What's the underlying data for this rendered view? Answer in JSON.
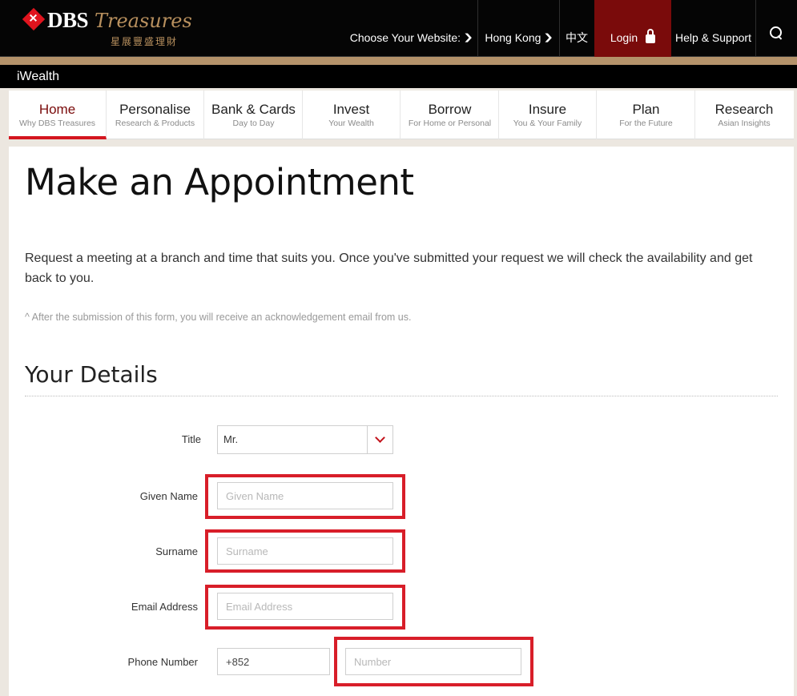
{
  "header": {
    "brand": "DBS",
    "brand_script": "Treasures",
    "brand_cn": "星展豐盛理財",
    "choose_website": "Choose Your Website:",
    "region": "Hong Kong",
    "language": "中文",
    "login": "Login",
    "help": "Help & Support",
    "subbar": "iWealth"
  },
  "nav": [
    {
      "title": "Home",
      "sub": "Why DBS Treasures"
    },
    {
      "title": "Personalise",
      "sub": "Research & Products"
    },
    {
      "title": "Bank & Cards",
      "sub": "Day to Day"
    },
    {
      "title": "Invest",
      "sub": "Your Wealth"
    },
    {
      "title": "Borrow",
      "sub": "For Home or Personal"
    },
    {
      "title": "Insure",
      "sub": "You & Your Family"
    },
    {
      "title": "Plan",
      "sub": "For the Future"
    },
    {
      "title": "Research",
      "sub": "Asian Insights"
    }
  ],
  "page": {
    "title": "Make an Appointment",
    "intro": "Request a meeting at a branch and time that suits you. Once you've submitted your request we will check the availability and get back to you.",
    "note": "^ After the submission of this form, you will receive an acknowledgement email from us.",
    "section": "Your Details"
  },
  "form": {
    "title_label": "Title",
    "title_value": "Mr.",
    "given_label": "Given Name",
    "given_placeholder": "Given Name",
    "surname_label": "Surname",
    "surname_placeholder": "Surname",
    "email_label": "Email Address",
    "email_placeholder": "Email Address",
    "phone_label": "Phone Number",
    "phone_code": "+852",
    "phone_placeholder": "Number"
  },
  "colors": {
    "accent": "#d4161f",
    "brand_dark_red": "#7a0b0b",
    "gold": "#b4926a"
  }
}
